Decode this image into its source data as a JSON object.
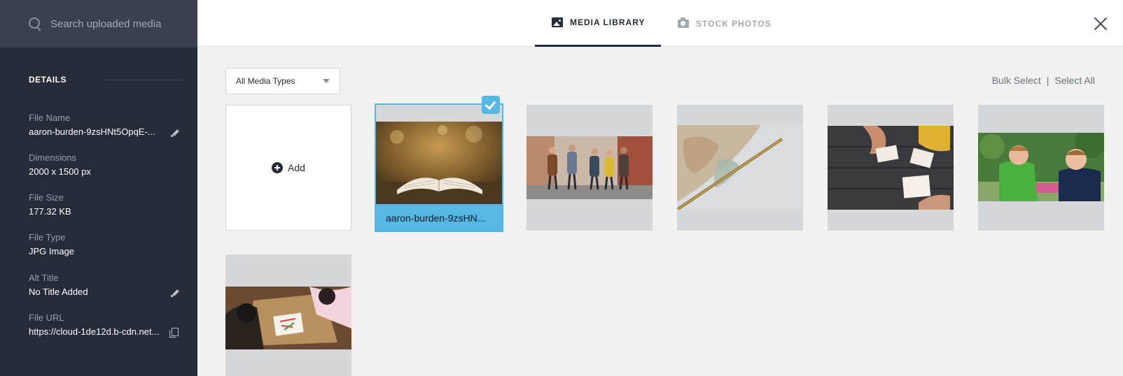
{
  "sidebar": {
    "search_placeholder": "Search uploaded media",
    "details_heading": "DETAILS",
    "fields": [
      {
        "label": "File Name",
        "value": "aaron-burden-9zsHNt5OpqE-..."
      },
      {
        "label": "Dimensions",
        "value": "2000 x 1500 px"
      },
      {
        "label": "File Size",
        "value": "177.32 KB"
      },
      {
        "label": "File Type",
        "value": "JPG Image"
      },
      {
        "label": "Alt Title",
        "value": "No Title Added"
      },
      {
        "label": "File URL",
        "value": "https://cloud-1de12d.b-cdn.net..."
      }
    ]
  },
  "header": {
    "tabs": [
      {
        "label": "MEDIA LIBRARY",
        "icon": "image-icon",
        "active": true
      },
      {
        "label": "STOCK PHOTOS",
        "icon": "camera-icon",
        "active": false
      }
    ]
  },
  "toolbar": {
    "media_type_selected": "All Media Types",
    "bulk_select": "Bulk Select",
    "separator": "|",
    "select_all": "Select All"
  },
  "grid": {
    "add_label": "Add",
    "items": [
      {
        "caption": "aaron-burden-9zsHN...",
        "selected": true,
        "subject": "open bible on blurred autumn background"
      },
      {
        "caption": "",
        "selected": false,
        "subject": "group of young people walking on sidewalk"
      },
      {
        "caption": "",
        "selected": false,
        "subject": "close-up of world globe"
      },
      {
        "caption": "",
        "selected": false,
        "subject": "people studying books at wooden table"
      },
      {
        "caption": "",
        "selected": false,
        "subject": "two boys laughing outdoors"
      },
      {
        "caption": "",
        "selected": false,
        "subject": "children drawing at a table"
      }
    ]
  },
  "colors": {
    "sidebar_bg": "#262b3a",
    "search_bg": "#3b404e",
    "accent": "#57b7e3",
    "main_bg": "#f1f1f1"
  }
}
